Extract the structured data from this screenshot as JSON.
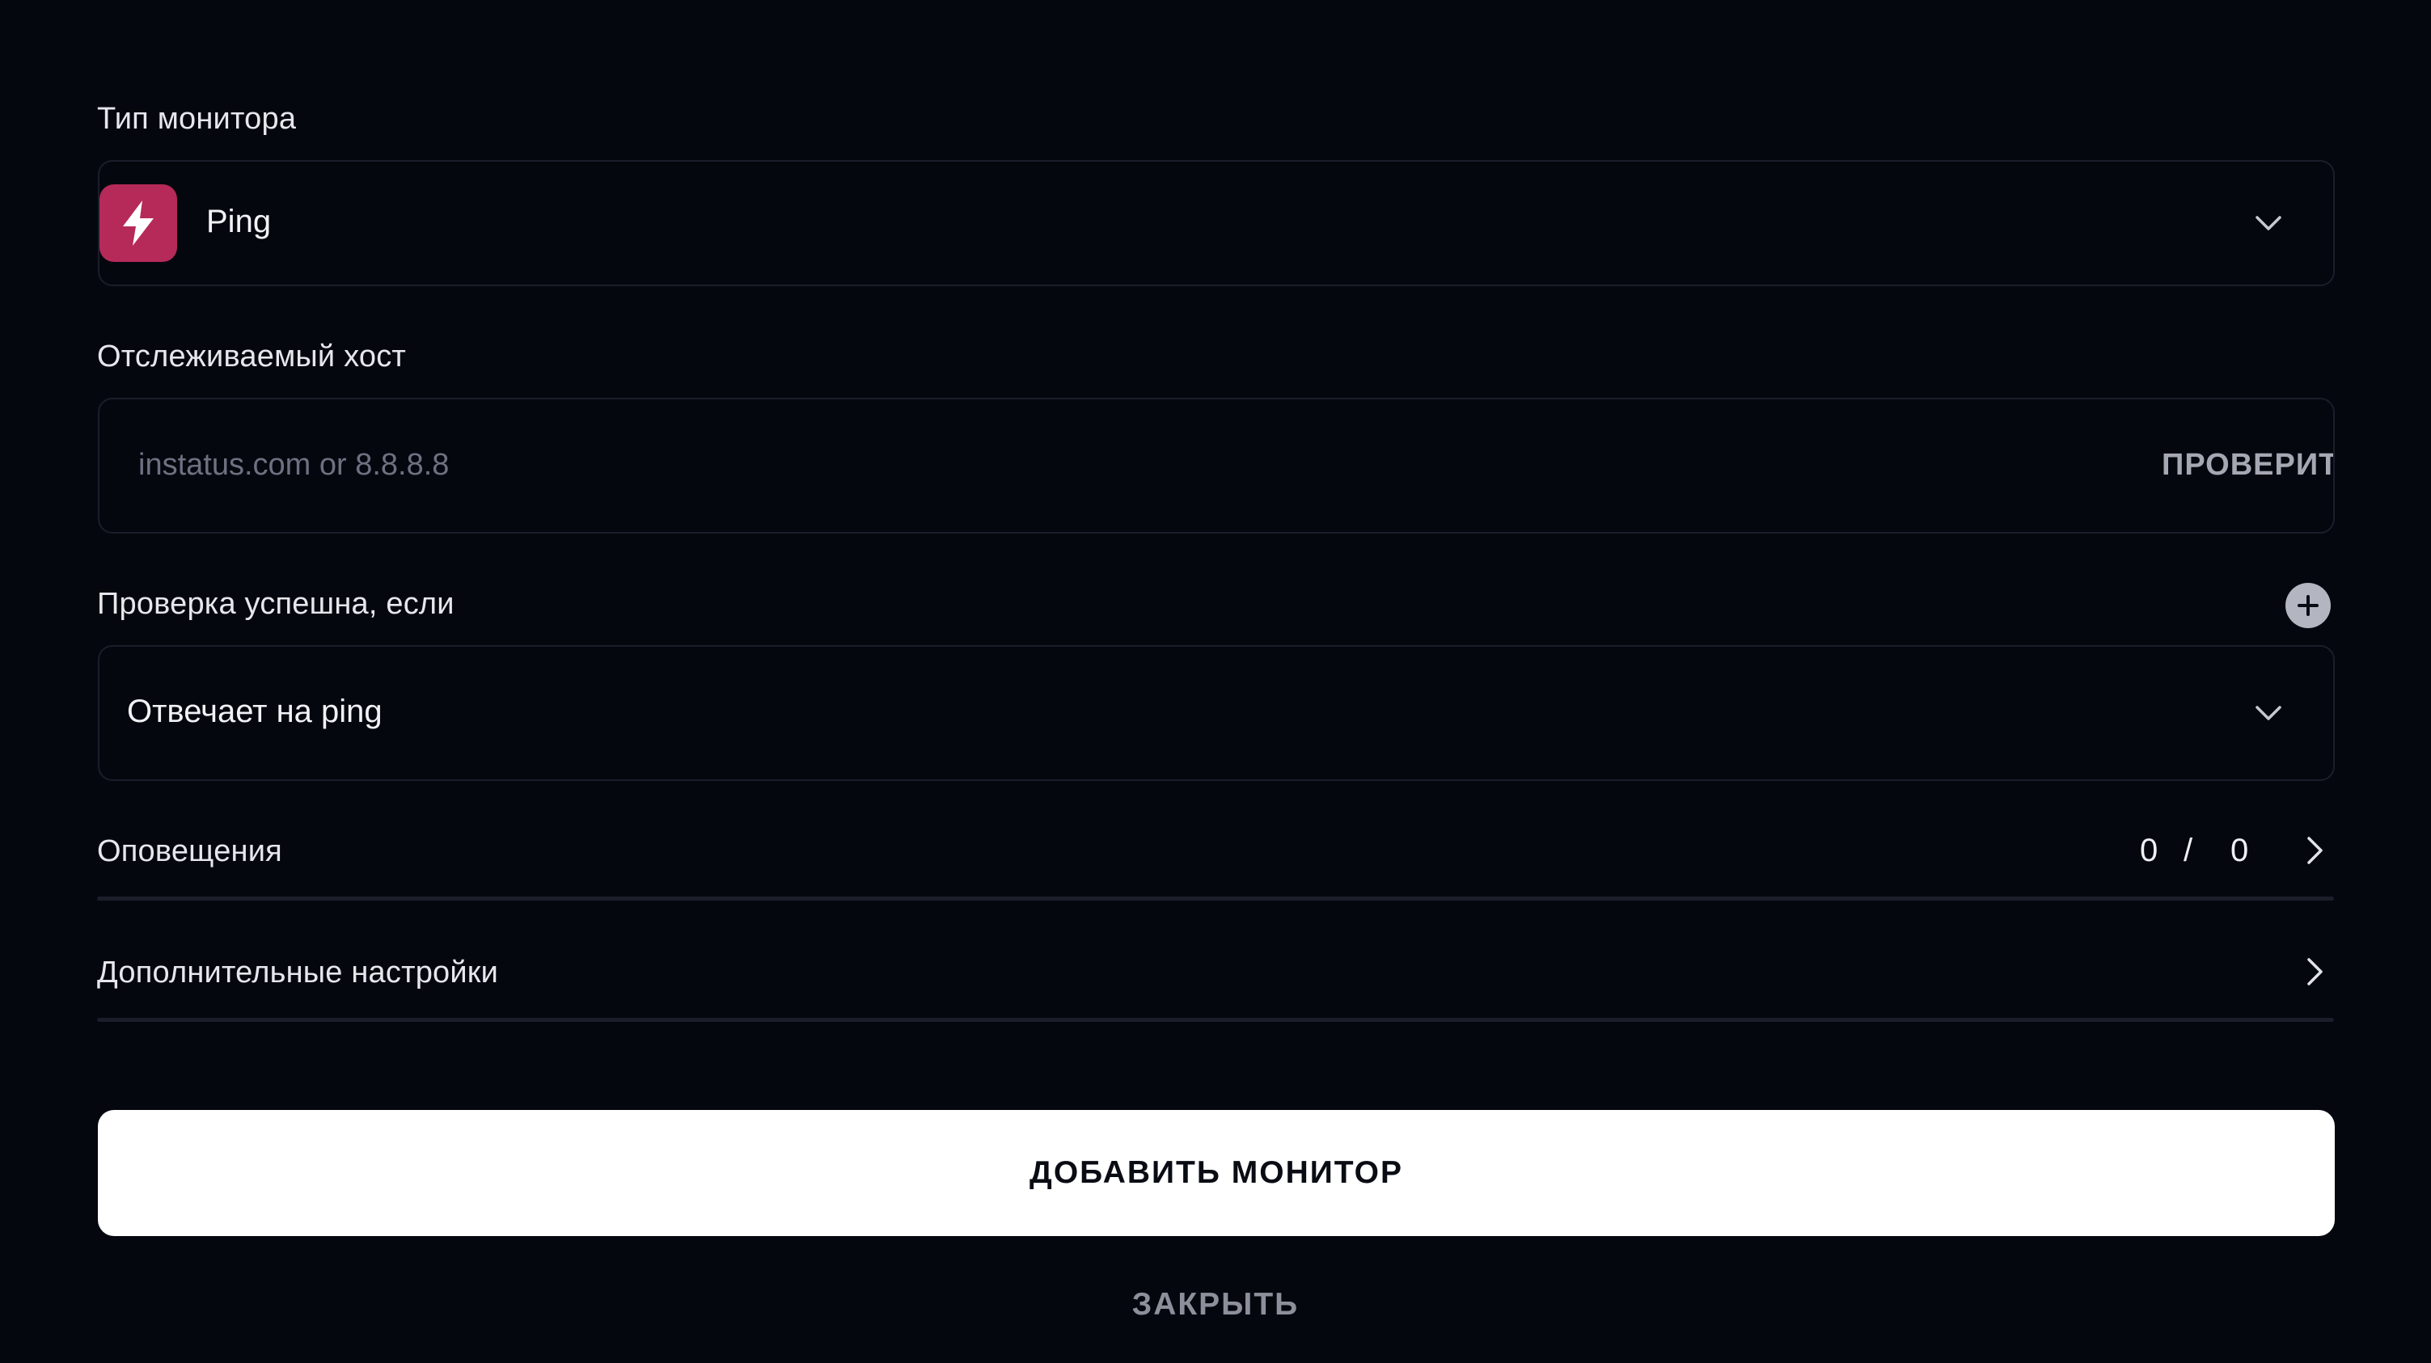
{
  "monitor_type": {
    "label": "Тип монитора",
    "selected_value": "Ping",
    "icon": "lightning-icon",
    "icon_color": "#b52a58"
  },
  "host": {
    "label": "Отслеживаемый хост",
    "placeholder": "instatus.com or 8.8.8.8",
    "value": "",
    "check_button": "ПРОВЕРИТЬ"
  },
  "condition": {
    "label": "Проверка успешна, если",
    "selected_value": "Отвечает на ping",
    "add_icon": "plus-circle-icon"
  },
  "notifications": {
    "label": "Оповещения",
    "count_a": "0",
    "separator": "/",
    "count_b": "0"
  },
  "advanced": {
    "label": "Дополнительные настройки"
  },
  "actions": {
    "submit_label": "ДОБАВИТЬ МОНИТОР",
    "close_label": "ЗАКРЫТЬ"
  },
  "colors": {
    "background": "#05070f",
    "border": "#1b1e2a",
    "accent": "#b52a58",
    "primary_button": "#ffffff"
  }
}
